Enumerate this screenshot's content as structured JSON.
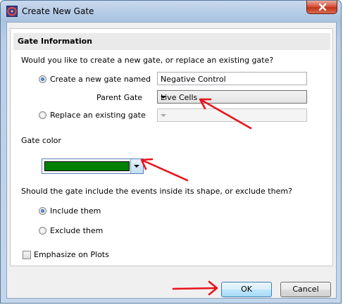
{
  "window": {
    "title": "Create New Gate",
    "icons": {
      "app": "gate-app-icon",
      "close": "close-icon"
    }
  },
  "group": {
    "header": "Gate Information"
  },
  "question_create": "Would you like to create a new gate, or replace an existing gate?",
  "create_option": {
    "label": "Create a new gate named",
    "selected": true,
    "name_value": "Negative Control"
  },
  "parent_gate": {
    "label": "Parent Gate",
    "selected_value": "Live Cells"
  },
  "replace_option": {
    "label": "Replace an existing gate",
    "selected": false,
    "selected_value": ""
  },
  "gate_color": {
    "label": "Gate color",
    "value": "#008000"
  },
  "question_include": "Should the gate include the events inside its shape, or exclude them?",
  "include_option": {
    "label": "Include them",
    "selected": true
  },
  "exclude_option": {
    "label": "Exclude them",
    "selected": false
  },
  "emphasize": {
    "label": "Emphasize on Plots",
    "checked": false
  },
  "buttons": {
    "ok": "OK",
    "cancel": "Cancel"
  },
  "annotation_color": "#e8141b"
}
